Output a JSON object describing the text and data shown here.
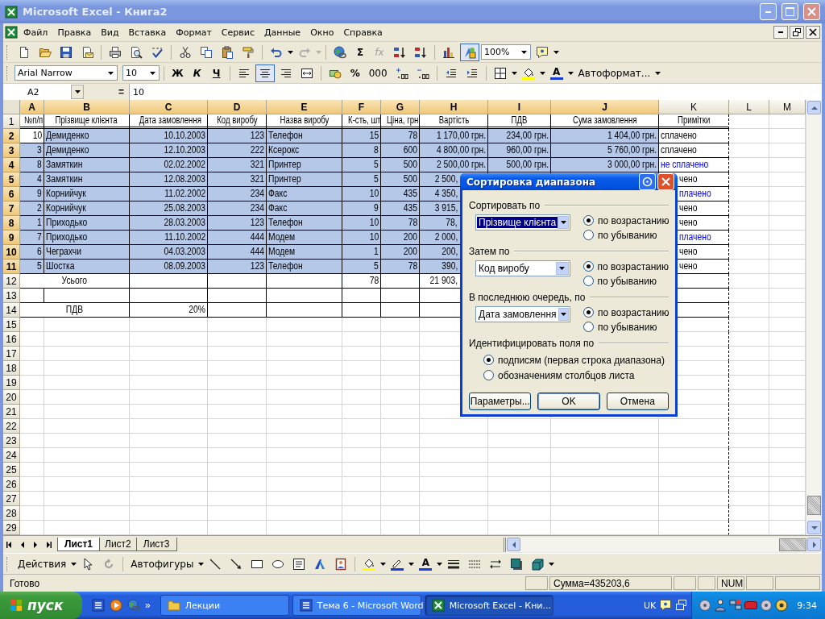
{
  "window": {
    "title": "Microsoft Excel - Книга2"
  },
  "menu": [
    "Файл",
    "Правка",
    "Вид",
    "Вставка",
    "Формат",
    "Сервис",
    "Данные",
    "Окно",
    "Справка"
  ],
  "standard_toolbar": {
    "sum": "Σ",
    "function": "fx",
    "redo_disabled": true,
    "drawing_pressed": true,
    "zoom": "100%"
  },
  "formatting_toolbar": {
    "font": "Arial Narrow",
    "size": "10",
    "bold": "Ж",
    "italic": "К",
    "underline": "Ч",
    "align_left_pressed": false,
    "align_center_pressed": true,
    "align_right_pressed": false,
    "percent": "%",
    "thousands": "000",
    "font_color": "A",
    "autoformat": "Автоформат..."
  },
  "formula_bar": {
    "name_box": "A2",
    "equals": "=",
    "value": "10"
  },
  "columns": [
    {
      "label": "A",
      "selected": true
    },
    {
      "label": "B",
      "selected": true
    },
    {
      "label": "C",
      "selected": true
    },
    {
      "label": "D",
      "selected": true
    },
    {
      "label": "E",
      "selected": true
    },
    {
      "label": "F",
      "selected": true
    },
    {
      "label": "G",
      "selected": true
    },
    {
      "label": "H",
      "selected": true
    },
    {
      "label": "I",
      "selected": true
    },
    {
      "label": "J",
      "selected": true
    },
    {
      "label": "K",
      "selected": false
    },
    {
      "label": "L",
      "selected": false
    },
    {
      "label": "M",
      "selected": false
    }
  ],
  "rows": [
    {
      "number": "1",
      "selected": false,
      "cells": [
        "№п/п",
        "Прізвище клієнта",
        "Дата замовлення",
        "Код виробу",
        "Назва виробу",
        "К-сть, шт",
        "Ціна, грн",
        "Вартість",
        "ПДВ",
        "Сума замовлення",
        "Примітки"
      ]
    },
    {
      "number": "2",
      "selected": true,
      "active": true,
      "unpaid": false,
      "cells": [
        "10",
        "Демиденко",
        "10.10.2003",
        "123",
        "Телефон",
        "15",
        "78",
        "1 170,00 грн.",
        "234,00 грн.",
        "1 404,00 грн.",
        "сплачено"
      ]
    },
    {
      "number": "3",
      "selected": true,
      "unpaid": false,
      "cells": [
        "3",
        "Демиденко",
        "12.10.2003",
        "222",
        "Ксерокс",
        "8",
        "600",
        "4 800,00 грн.",
        "960,00 грн.",
        "5 760,00 грн.",
        "сплачено"
      ]
    },
    {
      "number": "4",
      "selected": true,
      "unpaid": true,
      "cells": [
        "8",
        "Замяткин",
        "02.02.2002",
        "321",
        "Принтер",
        "5",
        "500",
        "2 500,00 грн.",
        "500,00 грн.",
        "3 000,00 грн.",
        "не сплачено"
      ]
    },
    {
      "number": "5",
      "selected": true,
      "unpaid": false,
      "cells": [
        "4",
        "Замяткин",
        "12.08.2003",
        "321",
        "Принтер",
        "5",
        "500",
        "2 500,",
        null,
        null,
        "чено"
      ]
    },
    {
      "number": "6",
      "selected": true,
      "unpaid": true,
      "cells": [
        "9",
        "Корнийчук",
        "11.02.2002",
        "234",
        "Факс",
        "10",
        "435",
        "4 350,",
        null,
        null,
        "плачено"
      ]
    },
    {
      "number": "7",
      "selected": true,
      "unpaid": false,
      "cells": [
        "2",
        "Корнийчук",
        "25.08.2003",
        "234",
        "Факс",
        "9",
        "435",
        "3 915,",
        null,
        null,
        "чено"
      ]
    },
    {
      "number": "8",
      "selected": true,
      "unpaid": false,
      "cells": [
        "1",
        "Приходько",
        "28.03.2003",
        "123",
        "Телефон",
        "10",
        "78",
        "78,",
        null,
        null,
        "чено"
      ]
    },
    {
      "number": "9",
      "selected": true,
      "unpaid": true,
      "cells": [
        "7",
        "Приходько",
        "11.10.2002",
        "444",
        "Модем",
        "10",
        "200",
        "2 000,",
        null,
        null,
        "плачено"
      ]
    },
    {
      "number": "10",
      "selected": true,
      "unpaid": false,
      "cells": [
        "6",
        "Чеграхчи",
        "04.03.2003",
        "444",
        "Модем",
        "1",
        "200",
        "200,",
        null,
        null,
        "чено"
      ]
    },
    {
      "number": "11",
      "selected": true,
      "unpaid": false,
      "cells": [
        "5",
        "Шостка",
        "08.09.2003",
        "123",
        "Телефон",
        "5",
        "78",
        "390,",
        null,
        null,
        "чено"
      ]
    },
    {
      "number": "12",
      "selected": false,
      "label": "Усього",
      "cells": [
        null,
        null,
        null,
        "78",
        null,
        "21 903,"
      ]
    },
    {
      "number": "13",
      "selected": false
    },
    {
      "number": "14",
      "selected": false,
      "label": "ПДВ",
      "cells": [
        "20%"
      ]
    },
    {
      "number": "15",
      "selected": false
    },
    {
      "number": "16",
      "selected": false
    },
    {
      "number": "17",
      "selected": false
    },
    {
      "number": "18",
      "selected": false
    },
    {
      "number": "19",
      "selected": false
    },
    {
      "number": "20",
      "selected": false
    },
    {
      "number": "21",
      "selected": false
    },
    {
      "number": "22",
      "selected": false
    },
    {
      "number": "23",
      "selected": false
    },
    {
      "number": "24",
      "selected": false
    },
    {
      "number": "25",
      "selected": false
    },
    {
      "number": "26",
      "selected": false
    },
    {
      "number": "27",
      "selected": false
    },
    {
      "number": "28",
      "selected": false
    },
    {
      "number": "29",
      "selected": false
    }
  ],
  "sort_dialog": {
    "title": "Сортировка диапазона",
    "keys": [
      {
        "label": "Сортировать по",
        "field": "Прізвище клієнта",
        "focused": true,
        "options": [
          {
            "label": "по возрастанию",
            "selected": true
          },
          {
            "label": "по убыванию",
            "selected": false
          }
        ]
      },
      {
        "label": "Затем по",
        "field": "Код виробу",
        "focused": false,
        "options": [
          {
            "label": "по возрастанию",
            "selected": true
          },
          {
            "label": "по убыванию",
            "selected": false
          }
        ]
      },
      {
        "label": "В последнюю очередь, по",
        "field": "Дата замовлення",
        "focused": false,
        "options": [
          {
            "label": "по возрастанию",
            "selected": true
          },
          {
            "label": "по убыванию",
            "selected": false
          }
        ]
      }
    ],
    "identify": {
      "label": "Идентифицировать поля по",
      "options": [
        {
          "label": "подписям (первая строка диапазона)",
          "selected": true
        },
        {
          "label": "обозначениям столбцов листа",
          "selected": false
        }
      ]
    },
    "buttons": [
      {
        "label": "Параметры...",
        "default": false
      },
      {
        "label": "OK",
        "default": true
      },
      {
        "label": "Отмена",
        "default": false
      }
    ]
  },
  "sheet_tabs": [
    {
      "label": "Лист1",
      "selected": true
    },
    {
      "label": "Лист2",
      "selected": false
    },
    {
      "label": "Лист3",
      "selected": false
    }
  ],
  "drawing_toolbar": {
    "actions": "Действия",
    "autoshapes": "Автофигуры",
    "font_color": "A"
  },
  "status_bar": {
    "text": "Готово",
    "sum": "Сумма=435203,6",
    "num": "NUM"
  },
  "taskbar": {
    "start": "пуск",
    "chevron": "»",
    "tasks": [
      {
        "label": "Лекции",
        "selected": false
      },
      {
        "label": "Тема 6 - Microsoft Word",
        "selected": false
      },
      {
        "label": "Microsoft Excel - Кни...",
        "selected": true
      }
    ],
    "language": "UK",
    "clock": "9:34"
  }
}
